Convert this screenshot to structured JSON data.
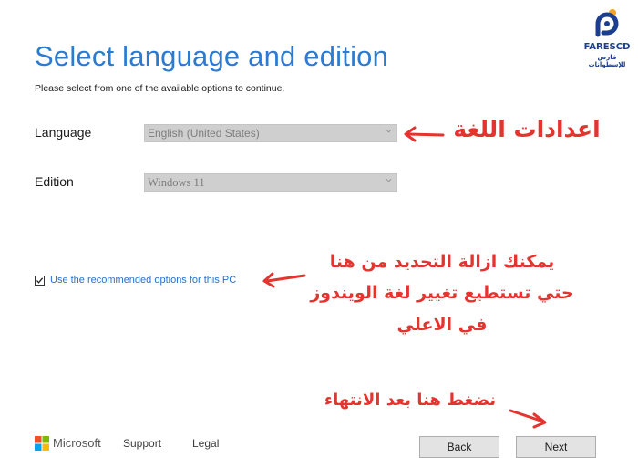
{
  "header": {
    "title": "Select language and edition",
    "subtitle": "Please select from one of the available options to continue."
  },
  "form": {
    "language_label": "Language",
    "language_value": "English (United States)",
    "edition_label": "Edition",
    "edition_value": "Windows 11",
    "recommended_label": "Use the recommended options for this PC",
    "recommended_checked": true
  },
  "annotations": {
    "language_settings": "اعدادات اللغة",
    "uncheck_line1": "يمكنك ازالة التحديد من هنا",
    "uncheck_line2": "حتي تستطيع تغيير لغة الويندوز",
    "uncheck_line3": "في الاعلي",
    "press_next": "نضغط هنا بعد الانتهاء"
  },
  "branding": {
    "logo_name": "FARESCD",
    "logo_tagline": "فارس للإسطوانات"
  },
  "footer": {
    "microsoft": "Microsoft",
    "support": "Support",
    "legal": "Legal",
    "back": "Back",
    "next": "Next"
  },
  "colors": {
    "title_blue": "#2b7bd3",
    "annotation_red": "#e3342f",
    "logo_blue": "#1c3e8f",
    "logo_orange": "#f5a31a"
  },
  "icons": [
    "fares-logo-icon",
    "chevron-down-icon",
    "checkmark-icon",
    "microsoft-logo-icon",
    "red-arrow-icon"
  ]
}
